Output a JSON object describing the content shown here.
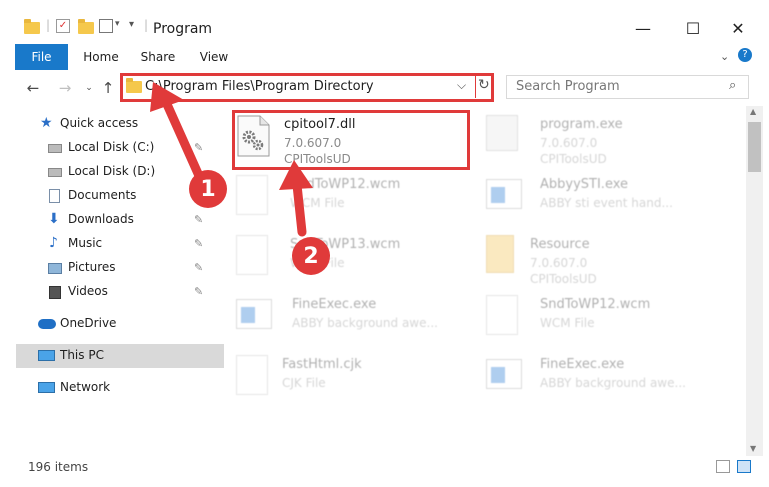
{
  "window": {
    "title": "Program",
    "buttons": {
      "minimize": "—",
      "maximize": "☐",
      "close": "✕"
    }
  },
  "ribbon": {
    "tabs": [
      "File",
      "Home",
      "Share",
      "View"
    ],
    "help": "?"
  },
  "address": {
    "path": "C:\\Program Files\\Program Directory",
    "dropdown": "⌵",
    "refresh": "↻",
    "search_placeholder": "Search Program"
  },
  "sidebar": {
    "items": [
      {
        "label": "Quick access",
        "icon": "star-icon",
        "pinned": false
      },
      {
        "label": "Local Disk (C:)",
        "icon": "drive-icon",
        "pinned": true
      },
      {
        "label": "Local Disk (D:)",
        "icon": "drive-icon",
        "pinned": false
      },
      {
        "label": "Documents",
        "icon": "documents-icon",
        "pinned": true
      },
      {
        "label": "Downloads",
        "icon": "download-icon",
        "pinned": true
      },
      {
        "label": "Music",
        "icon": "music-icon",
        "pinned": true
      },
      {
        "label": "Pictures",
        "icon": "pictures-icon",
        "pinned": true
      },
      {
        "label": "Videos",
        "icon": "videos-icon",
        "pinned": true
      },
      {
        "label": "OneDrive",
        "icon": "cloud-icon",
        "pinned": false
      },
      {
        "label": "This PC",
        "icon": "computer-icon",
        "pinned": false,
        "selected": true
      },
      {
        "label": "Network",
        "icon": "network-icon",
        "pinned": false
      }
    ]
  },
  "files": [
    {
      "name": "cpitool7.dll",
      "line1": "7.0.607.0",
      "line2": "CPIToolsUD",
      "icon": "dll-gear-icon"
    },
    {
      "name": "program.exe",
      "line1": "7.0.607.0",
      "line2": "CPIToolsUD",
      "icon": "program-icon"
    },
    {
      "name": "SndToWP12.wcm",
      "line1": "WCM File",
      "line2": "",
      "icon": "blank-file-icon"
    },
    {
      "name": "AbbyySTI.exe",
      "line1": "ABBY sti event hand...",
      "line2": "",
      "icon": "window-app-icon"
    },
    {
      "name": "SndToWP13.wcm",
      "line1": "WCM File",
      "line2": "",
      "icon": "blank-file-icon"
    },
    {
      "name": "Resource",
      "line1": "7.0.607.0",
      "line2": "CPIToolsUD",
      "icon": "folder-icon"
    },
    {
      "name": "FineExec.exe",
      "line1": "ABBY background awe...",
      "line2": "",
      "icon": "window-app-icon"
    },
    {
      "name": "SndToWP12.wcm",
      "line1": "WCM File",
      "line2": "",
      "icon": "blank-file-icon"
    },
    {
      "name": "FastHtml.cjk",
      "line1": "CJK File",
      "line2": "",
      "icon": "blank-file-icon"
    },
    {
      "name": "FineExec.exe",
      "line1": "ABBY background awe...",
      "line2": "",
      "icon": "window-app-icon"
    }
  ],
  "callouts": [
    "1",
    "2"
  ],
  "status": {
    "items_count": "196 items"
  },
  "colors": {
    "accent": "#1979ca",
    "callout": "#e03a3a",
    "folder": "#f5c84c"
  }
}
